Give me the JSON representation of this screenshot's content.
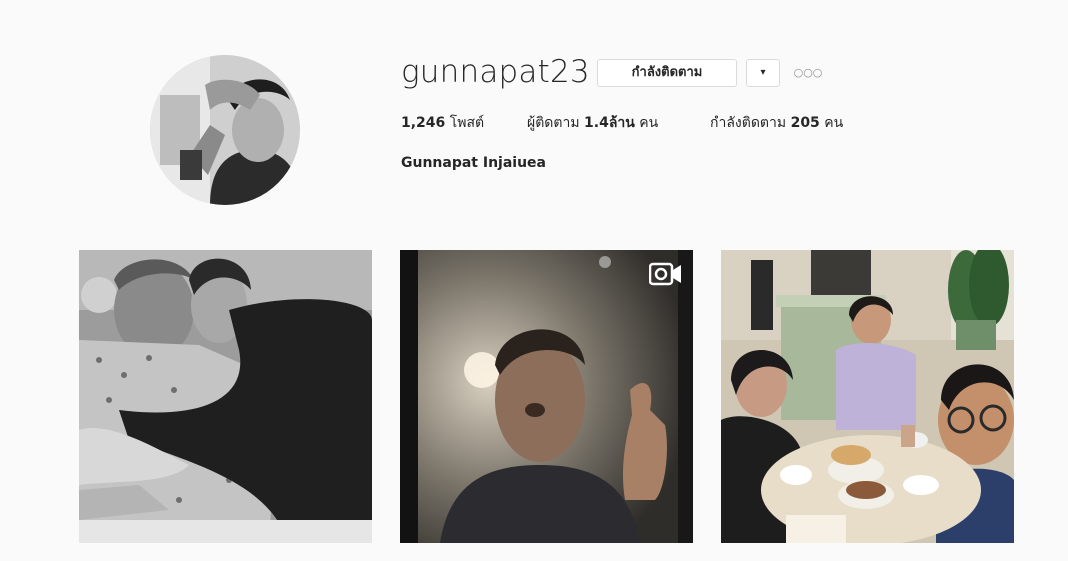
{
  "profile": {
    "username": "gunnapat23",
    "following_button_label": "กำลังติดตาม",
    "dropdown_label": "▾",
    "options_label": "○○○",
    "full_name": "Gunnapat Injaiuea"
  },
  "stats": {
    "posts_count": "1,246",
    "posts_label": "โพสต์",
    "followers_label": "ผู้ติดตาม",
    "followers_count": "1.4ล้าน",
    "followers_unit": "คน",
    "following_label": "กำลังติดตาม",
    "following_count": "205",
    "following_unit": "คน"
  },
  "posts": [
    {
      "type": "photo",
      "description_icon": "photo-bw"
    },
    {
      "type": "video",
      "badge_icon": "video-camera-icon"
    },
    {
      "type": "photo",
      "description_icon": "photo-color"
    }
  ],
  "colors": {
    "background": "#fafafa",
    "text": "#262626",
    "border": "#dbdbdb",
    "muted": "#8e8e8e"
  }
}
